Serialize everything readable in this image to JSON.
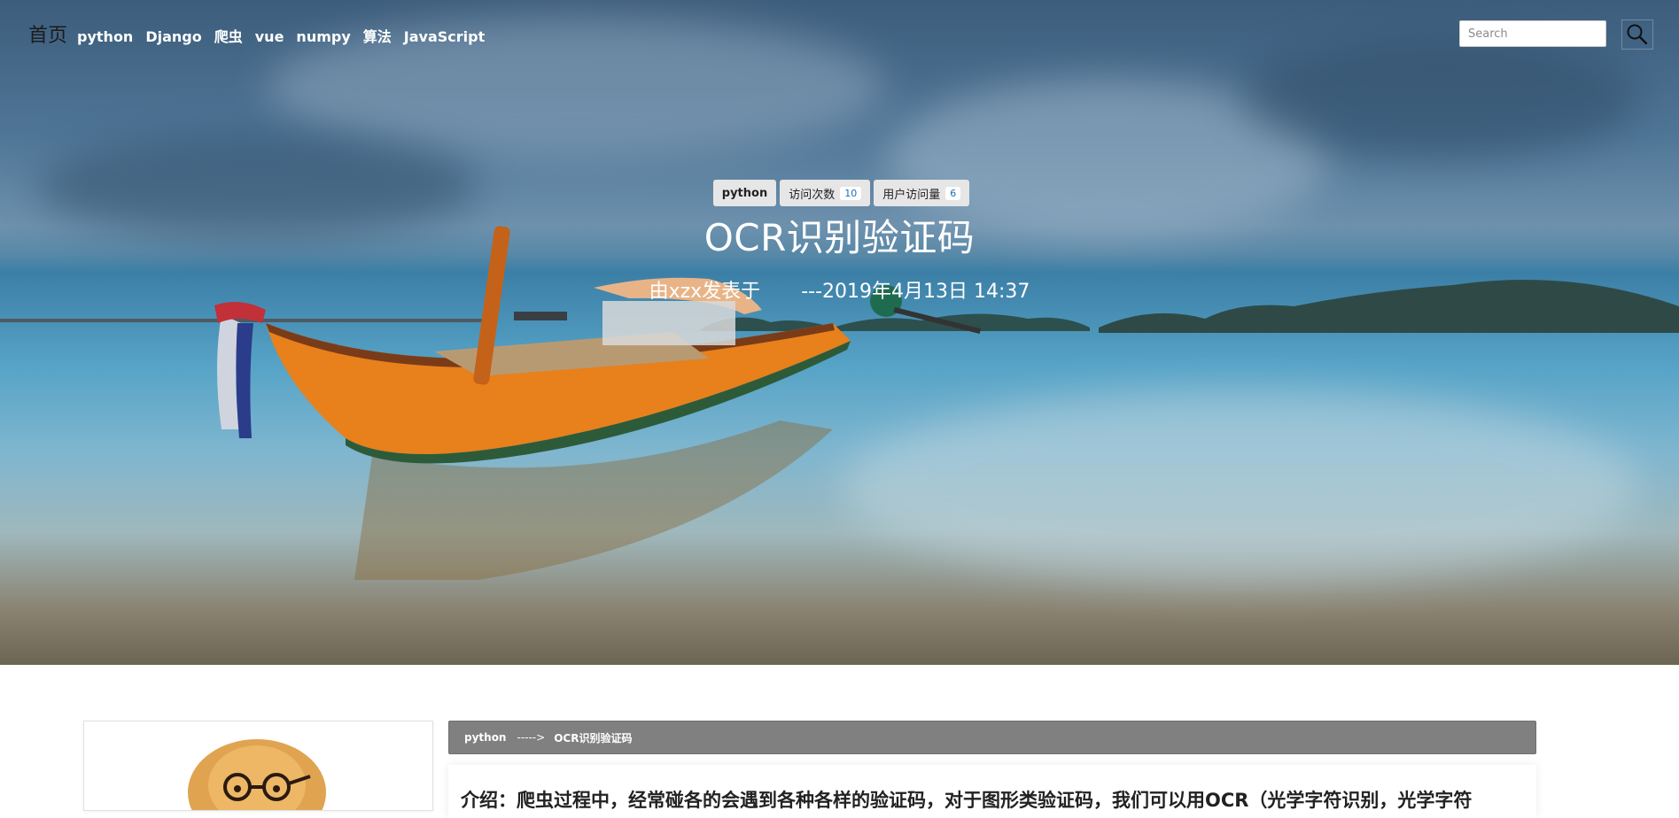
{
  "nav": {
    "brand": "首页",
    "links": [
      "python",
      "Django",
      "爬虫",
      "vue",
      "numpy",
      "算法",
      "JavaScript"
    ],
    "search_placeholder": "Search",
    "search_icon": "search-icon"
  },
  "post": {
    "category": "python",
    "visits_label": "访问次数",
    "visits_count": "10",
    "users_label": "用户访问量",
    "users_count": "6",
    "title": "OCR识别验证码",
    "author_text": "由xzx发表于",
    "date_text": "---2019年4月13日 14:37"
  },
  "breadcrumb": {
    "category": "python",
    "separator": "----->",
    "current": "OCR识别验证码"
  },
  "article": {
    "intro": "介绍：爬虫过程中，经常碰各的会遇到各种各样的验证码，对于图形类验证码，我们可以用OCR（光学字符识别，光学字符"
  },
  "colors": {
    "breadcrumb_bg": "#808080",
    "badge_bg": "#e6e6e6",
    "count_color": "#1a6ec2"
  }
}
